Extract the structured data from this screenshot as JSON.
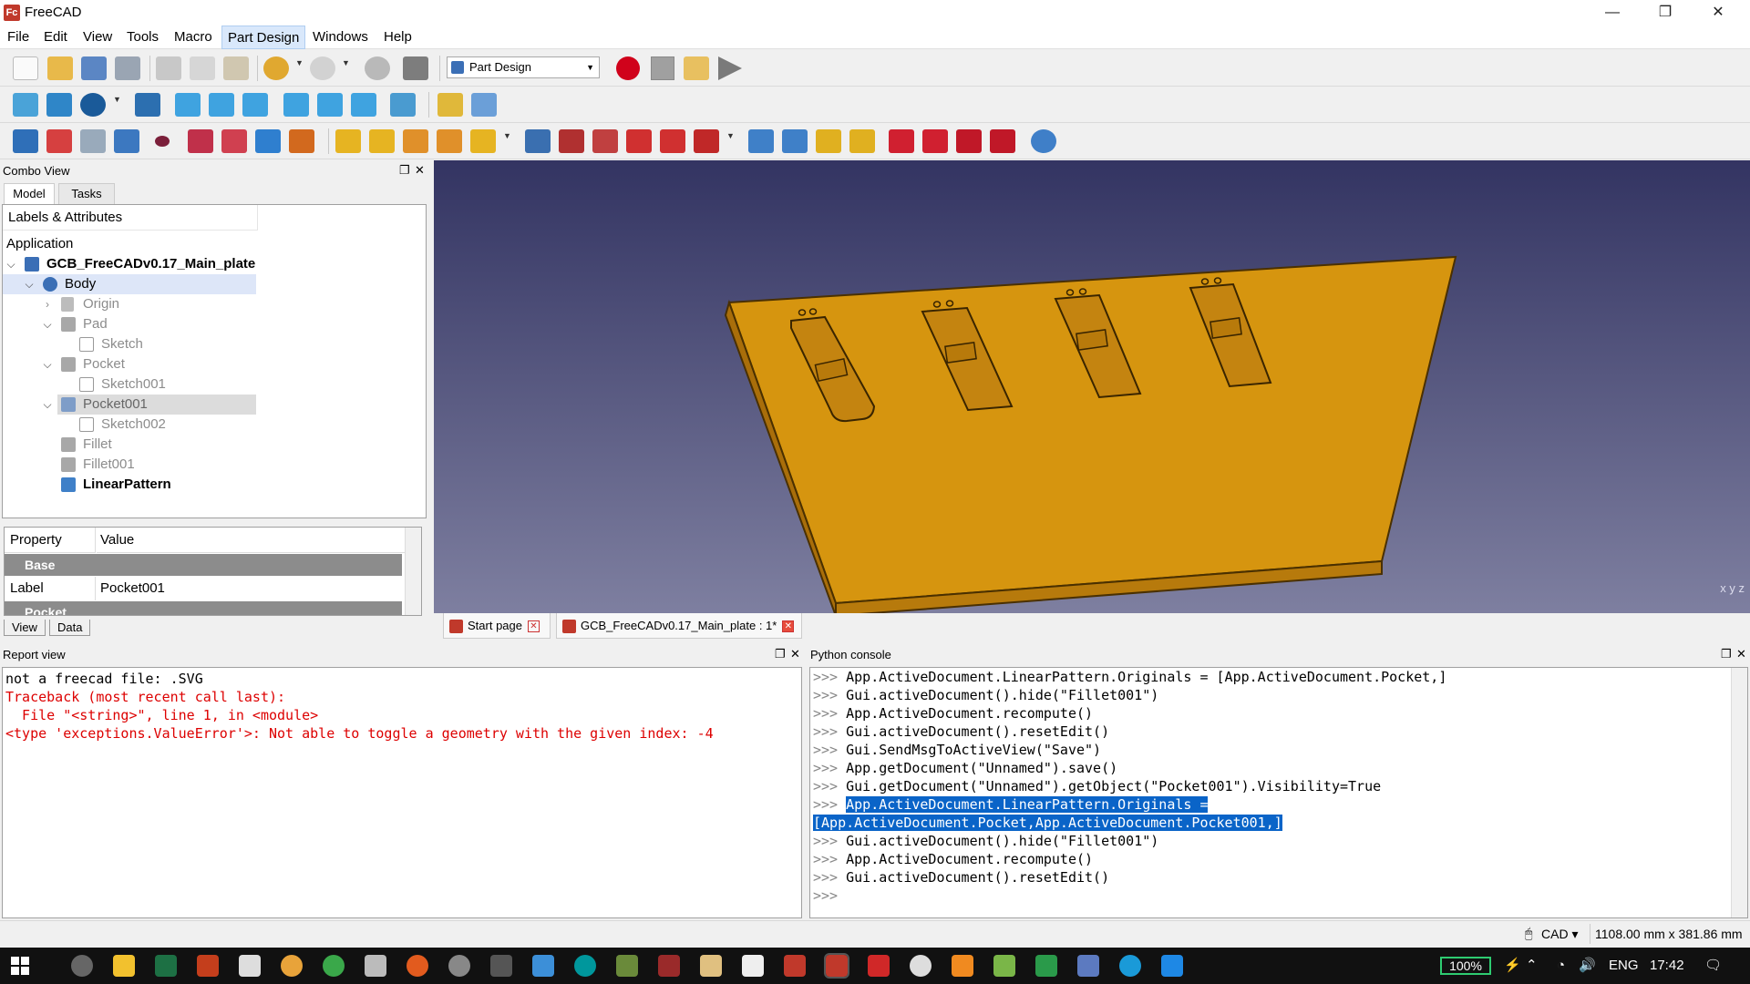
{
  "window": {
    "title": "FreeCAD",
    "logo_text": "Fc"
  },
  "menu": [
    "File",
    "Edit",
    "View",
    "Tools",
    "Macro",
    "Part Design",
    "Windows",
    "Help"
  ],
  "workbench": "Part Design",
  "combo": {
    "title": "Combo View",
    "tabs": [
      "Model",
      "Tasks"
    ],
    "tree_header": "Labels & Attributes",
    "tree": [
      {
        "label": "Application",
        "style": "plain"
      },
      {
        "label": "GCB_FreeCADv0.17_Main_plate",
        "style": "bold"
      },
      {
        "label": "Body",
        "style": "selected"
      },
      {
        "label": "Origin",
        "style": "grey"
      },
      {
        "label": "Pad",
        "style": "grey"
      },
      {
        "label": "Sketch",
        "style": "grey"
      },
      {
        "label": "Pocket",
        "style": "grey"
      },
      {
        "label": "Sketch001",
        "style": "grey"
      },
      {
        "label": "Pocket001",
        "style": "grey-selected"
      },
      {
        "label": "Sketch002",
        "style": "grey"
      },
      {
        "label": "Fillet",
        "style": "grey"
      },
      {
        "label": "Fillet001",
        "style": "grey"
      },
      {
        "label": "LinearPattern",
        "style": "bold"
      }
    ],
    "property": {
      "headers": [
        "Property",
        "Value"
      ],
      "groups": [
        "Base",
        "Pocket"
      ],
      "rows": [
        {
          "name": "Label",
          "value": "Pocket001"
        }
      ]
    },
    "bottom_tabs": [
      "View",
      "Data"
    ]
  },
  "doc_tabs": [
    "Start page",
    "GCB_FreeCADv0.17_Main_plate : 1*"
  ],
  "report": {
    "title": "Report view",
    "lines": [
      {
        "text": "not a freecad file: .SVG",
        "kind": "plain"
      },
      {
        "text": "Traceback (most recent call last):",
        "kind": "err"
      },
      {
        "text": "  File \"<string>\", line 1, in <module>",
        "kind": "err"
      },
      {
        "text": "<type 'exceptions.ValueError'>: Not able to toggle a geometry with the given index: -4",
        "kind": "err"
      }
    ]
  },
  "console": {
    "title": "Python console",
    "lines": [
      {
        "prompt": ">>> ",
        "code": "App.ActiveDocument.LinearPattern.Originals = [App.ActiveDocument.Pocket,]"
      },
      {
        "prompt": ">>> ",
        "code": "Gui.activeDocument().hide(\"Fillet001\")"
      },
      {
        "prompt": ">>> ",
        "code": "App.ActiveDocument.recompute()"
      },
      {
        "prompt": ">>> ",
        "code": "Gui.activeDocument().resetEdit()"
      },
      {
        "prompt": ">>> ",
        "code": "Gui.SendMsgToActiveView(\"Save\")"
      },
      {
        "prompt": ">>> ",
        "code": "App.getDocument(\"Unnamed\").save()"
      },
      {
        "prompt": ">>> ",
        "code": "Gui.getDocument(\"Unnamed\").getObject(\"Pocket001\").Visibility=True"
      },
      {
        "prompt": ">>> ",
        "code": "App.ActiveDocument.LinearPattern.Originals =",
        "highlight": true
      },
      {
        "prompt": "",
        "code": "[App.ActiveDocument.Pocket,App.ActiveDocument.Pocket001,]",
        "highlight": true
      },
      {
        "prompt": ">>> ",
        "code": "Gui.activeDocument().hide(\"Fillet001\")"
      },
      {
        "prompt": ">>> ",
        "code": "App.ActiveDocument.recompute()"
      },
      {
        "prompt": ">>> ",
        "code": "Gui.activeDocument().resetEdit()"
      },
      {
        "prompt": ">>> ",
        "code": ""
      }
    ]
  },
  "status": {
    "nav": "CAD",
    "dimensions": "1108.00 mm x 381.86 mm"
  },
  "taskbar": {
    "battery": "100%",
    "lang": "ENG",
    "time": "17:42"
  },
  "axis_label": "x y z",
  "colors": {
    "accent": "#0a64c8",
    "model": "#d18f12",
    "error": "#dd0000"
  }
}
